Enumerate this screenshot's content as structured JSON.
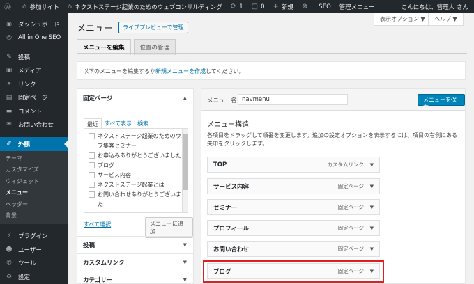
{
  "adminbar": {
    "items": [
      {
        "icon": "wordpress-logo-icon",
        "glyph": "Ⓦ",
        "label": ""
      },
      {
        "icon": "multisite-icon",
        "glyph": "⌂",
        "label": "参加サイト"
      },
      {
        "icon": "home-icon",
        "glyph": "⌂",
        "label": "ネクストステージ起業のためのウェブコンサルティング"
      },
      {
        "icon": "updates-icon",
        "glyph": "⟳",
        "label": "1"
      },
      {
        "icon": "comments-icon",
        "glyph": "▢",
        "label": "0"
      },
      {
        "icon": "plus-icon",
        "glyph": "+",
        "label": "新規"
      },
      {
        "icon": "aioseo-icon",
        "glyph": "⊗",
        "label": ""
      },
      {
        "icon": "",
        "glyph": "",
        "label": "SEO"
      },
      {
        "icon": "",
        "glyph": "",
        "label": "管理メニュー"
      }
    ],
    "greeting": "こんにちは、管理人 さん"
  },
  "sidebar": {
    "items": [
      {
        "name": "dashboard",
        "icon": "dashboard-icon",
        "glyph": "◉",
        "label": "ダッシュボード"
      },
      {
        "name": "aioseo",
        "icon": "aioseo-icon",
        "glyph": "◎",
        "label": "All in One SEO"
      },
      {
        "name": "posts",
        "icon": "pin-icon",
        "glyph": "✎",
        "label": "投稿"
      },
      {
        "name": "media",
        "icon": "media-icon",
        "glyph": "▣",
        "label": "メディア"
      },
      {
        "name": "links",
        "icon": "link-icon",
        "glyph": "⚭",
        "label": "リンク"
      },
      {
        "name": "pages",
        "icon": "page-icon",
        "glyph": "▤",
        "label": "固定ページ"
      },
      {
        "name": "comments",
        "icon": "comment-icon",
        "glyph": "▬",
        "label": "コメント"
      },
      {
        "name": "contact",
        "icon": "mail-icon",
        "glyph": "✉",
        "label": "お問い合わせ"
      },
      {
        "name": "appearance",
        "icon": "brush-icon",
        "glyph": "✐",
        "label": "外観"
      }
    ],
    "submenu": [
      "テーマ",
      "カスタマイズ",
      "ウィジェット",
      "メニュー",
      "ヘッダー",
      "背景"
    ],
    "items_after": [
      {
        "name": "plugins",
        "icon": "plugin-icon",
        "glyph": "⚡",
        "label": "プラグイン"
      },
      {
        "name": "users",
        "icon": "user-icon",
        "glyph": "☻",
        "label": "ユーザー"
      },
      {
        "name": "tools",
        "icon": "wrench-icon",
        "glyph": "✆",
        "label": "ツール"
      },
      {
        "name": "settings",
        "icon": "settings-icon",
        "glyph": "⚙",
        "label": "設定"
      }
    ]
  },
  "header": {
    "title": "メニュー",
    "action": "ライブプレビューで管理",
    "screen_options": "表示オプション ▼",
    "help": "ヘルプ ▼"
  },
  "tabs": [
    "メニューを編集",
    "位置の管理"
  ],
  "notice": {
    "before": "以下のメニューを編集するか",
    "link": "新規メニューを作成",
    "after": "してください。"
  },
  "accordion": {
    "pages_title": "固定ページ",
    "inner_tabs": [
      "最近",
      "すべて表示",
      "検索"
    ],
    "pages": [
      "ネクストステージ起業のためのウェブ集客セミナー",
      "お申込みありがとうございました",
      "ブログ",
      "サービス内容",
      "ネクストステージ起業とは",
      "お問い合わせありがとうございました"
    ],
    "select_all": "すべて選択",
    "add_button": "メニューに追加",
    "sections": [
      "投稿",
      "カスタムリンク",
      "カテゴリー"
    ]
  },
  "management": {
    "name_label": "メニュー名",
    "name_value": "navmenu",
    "save_label": "メニューを保存",
    "structure_title": "メニュー構造",
    "structure_desc": "各項目をドラッグして順番を変更します。追加の設定オプションを表示するには、項目の右側にある矢印をクリックします。",
    "items": [
      {
        "title": "TOP",
        "type": "カスタムリンク"
      },
      {
        "title": "サービス内容",
        "type": "固定ページ"
      },
      {
        "title": "セミナー",
        "type": "固定ページ"
      },
      {
        "title": "プロフィール",
        "type": "固定ページ"
      },
      {
        "title": "お問い合わせ",
        "type": "固定ページ"
      },
      {
        "title": "ブログ",
        "type": "固定ページ"
      }
    ],
    "highlight_color": "#e01e1e"
  }
}
